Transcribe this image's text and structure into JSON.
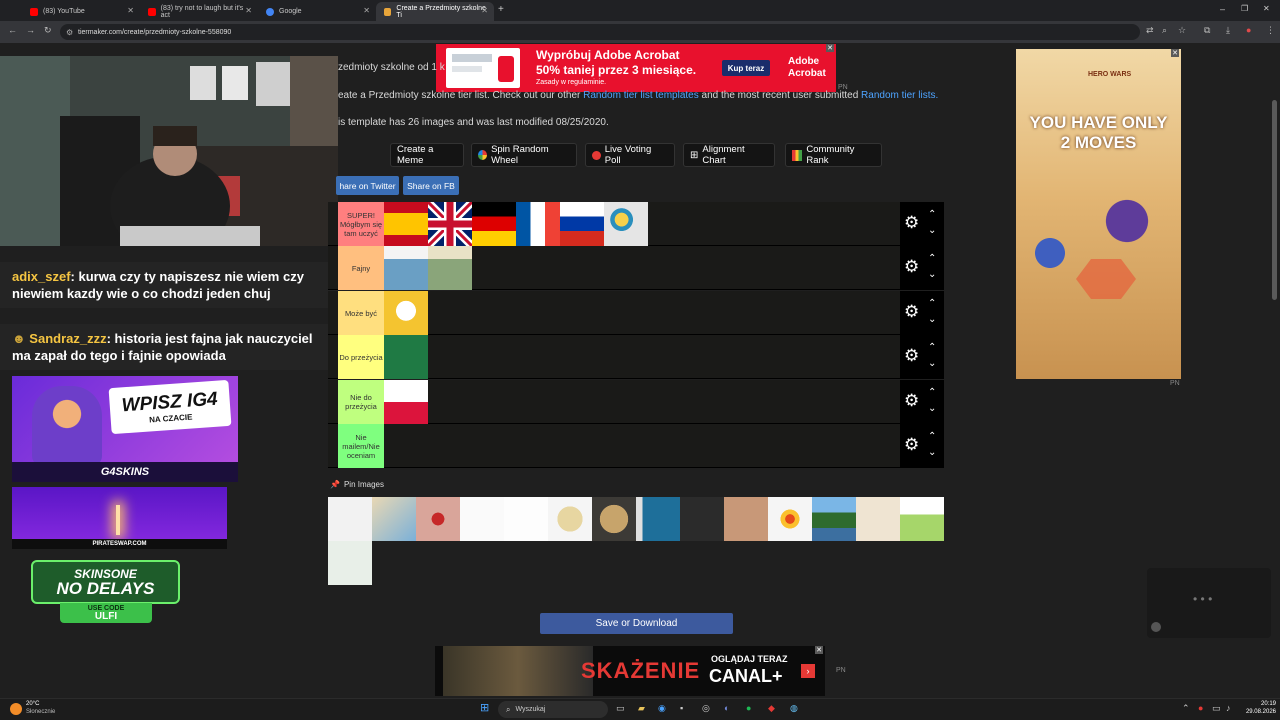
{
  "browser": {
    "tabs": [
      {
        "label": "(83) YouTube",
        "color": "#ff0000"
      },
      {
        "label": "(83) try not to laugh but it's act",
        "color": "#ff0000"
      },
      {
        "label": "Google",
        "color": "#4285f4"
      },
      {
        "label": "Create a Przedmioty szkolne Ti",
        "color": "#e8a53a"
      }
    ],
    "url": "tiermaker.com/create/przedmioty-szkolne-558090"
  },
  "stream": {
    "chat": [
      {
        "user": "adix_szef",
        "message": ": kurwa czy ty napiszesz nie wiem czy niewiem kazdy wie o co chodzi jeden chuj"
      },
      {
        "user": "Sandraz_zzz",
        "message": ": historia jest fajna jak nauczyciel ma zapał do tego i fajnie opowiada"
      }
    ],
    "promo1": {
      "headline": "WPISZ IG4",
      "sub": "NA CZACIE",
      "brand": "G4SKINS"
    },
    "promo2": {
      "brand": "PIRATESWAP.COM"
    },
    "promo3": {
      "line1": "SKINSONE",
      "line2": "NO DELAYS",
      "line3": "USE CODE",
      "code": "ULFI"
    }
  },
  "ads": {
    "top": {
      "line1": "Wypróbuj Adobe Acrobat",
      "line2": "50% taniej przez 3 miesiące.",
      "line3": "Zasady w regulaminie.",
      "cta": "Kup teraz",
      "brand1": "Adobe",
      "brand2": "Acrobat"
    },
    "side": {
      "brand": "HERO WARS",
      "line1": "YOU HAVE ONLY",
      "line2": "2 MOVES"
    },
    "bottom": {
      "title": "SKAŻENIE",
      "cta": "OGLĄDAJ TERAZ",
      "brand": "CANAL+"
    },
    "pn": "PN"
  },
  "page": {
    "title_fragment": "zedmioty szkolne od 1 k",
    "desc": "eate a Przedmioty szkolne tier list. Check out our other ",
    "link1": "Random tier list templates",
    "desc2": " and the most recent user submitted ",
    "link2": "Random tier lists.",
    "info": "is template has 26 images and was last modified 08/25/2020.",
    "buttons": {
      "meme": "Create a Meme",
      "wheel": "Spin Random Wheel",
      "poll": "Live Voting Poll",
      "alignment": "Alignment Chart",
      "rank": "Community Rank"
    },
    "share_twitter": "hare on Twitter",
    "share_fb": "Share on FB",
    "pin_label": "Pin Images",
    "save_label": "Save or Download"
  },
  "tiers": [
    {
      "label": "SUPER! Mógłbym się tam uczyć",
      "color": "#ff7f7f"
    },
    {
      "label": "Fajny",
      "color": "#ffbf7f"
    },
    {
      "label": "Może być",
      "color": "#ffdf7f"
    },
    {
      "label": "Do przeżycia",
      "color": "#ffff7f"
    },
    {
      "label": "Nie do przeżycia",
      "color": "#bfff7f"
    },
    {
      "label": "Nie mailem/Nie oceniam",
      "color": "#7fff7f"
    }
  ],
  "taskbar": {
    "weather_temp": "20°C",
    "weather_desc": "Słonecznie",
    "search": "Wyszukaj",
    "time": "20:19",
    "date": "29.08.2026"
  }
}
